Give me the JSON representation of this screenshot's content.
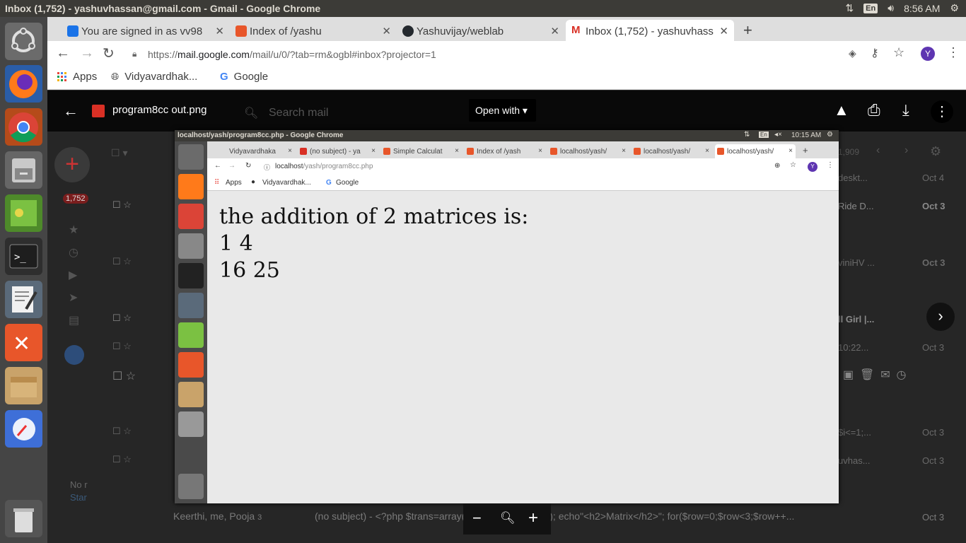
{
  "os": {
    "window_title": "Inbox (1,752) - yashuvhassan@gmail.com - Gmail - Google Chrome",
    "lang": "En",
    "time": "8:56 AM"
  },
  "tabs": [
    {
      "label": "You are signed in as vv98",
      "favicon_color": "#1a73e8"
    },
    {
      "label": "Index of /yashu",
      "favicon_color": "#e8562a"
    },
    {
      "label": "Yashuvijay/weblab",
      "favicon_color": "#24292e"
    },
    {
      "label": "Inbox (1,752) - yashuvhass",
      "favicon_color": "#d93025"
    }
  ],
  "address": {
    "scheme": "https://",
    "host": "mail.google.com",
    "path": "/mail/u/0/?tab=rm&ogbl#inbox?projector=1"
  },
  "profile_initial": "Y",
  "bookmarks": {
    "apps": "Apps",
    "b1": "Vidyavardhak...",
    "b2": "Google"
  },
  "viewer": {
    "filename": "program8cc out.png",
    "open_with": "Open with",
    "search_placeholder": "Search mail"
  },
  "gmail_rows": [
    {
      "sender": "",
      "snippet": "deskt...",
      "date": "Oct 4"
    },
    {
      "sender": "",
      "snippet": "Ride D...",
      "date": "Oct 3"
    },
    {
      "sender": "",
      "snippet": "viniHV ...",
      "date": "Oct 3"
    },
    {
      "sender": "",
      "snippet": "ll Girl |...",
      "date": "Oct 3"
    },
    {
      "sender": "",
      "snippet": "10:22...",
      "date": "Oct 3"
    },
    {
      "sender": "",
      "snippet": "$i<=1;...",
      "date": "Oct 3"
    },
    {
      "sender": "",
      "snippet": "uvhas...",
      "date": "Oct 3"
    }
  ],
  "gmail_bottom_row": {
    "sender": "Keerthi, me, Pooja",
    "count": "3",
    "snippet": "(no subject) - <?php $trans=array(   3,4,9) array(5,6,9) ); echo\"<h2>Matrix</h2>\"; for($row=0;$row<3;$row++...",
    "date": "Oct 3"
  },
  "gmail_count": "1,909",
  "gmail_badge": "1,752",
  "gmail_side": {
    "no": "No r",
    "star": "Star"
  },
  "inner": {
    "window_title": "localhost/yash/program8cc.php - Google Chrome",
    "lang": "En",
    "time": "10:15 AM",
    "tabs": [
      "Vidyavardhaka",
      "(no subject) - ya",
      "Simple Calculat",
      "Index of /yash",
      "localhost/yash/",
      "localhost/yash/",
      "localhost/yash/"
    ],
    "url_host": "localhost",
    "url_path": "/yash/program8cc.php",
    "bookmarks": {
      "apps": "Apps",
      "b1": "Vidyavardhak...",
      "b2": "Google"
    },
    "content": {
      "heading": "the addition of 2 matrices is:",
      "row1": "1 4",
      "row2": "16 25"
    }
  }
}
